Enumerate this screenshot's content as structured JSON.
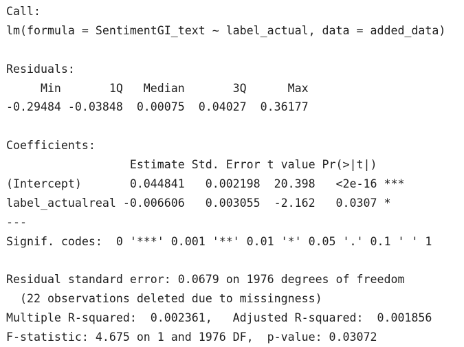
{
  "output": {
    "lines": [
      "Call:",
      "lm(formula = SentimentGI_text ~ label_actual, data = added_data)",
      "",
      "Residuals:",
      "     Min       1Q   Median       3Q      Max ",
      "-0.29484 -0.03848  0.00075  0.04027  0.36177 ",
      "",
      "Coefficients:",
      "                  Estimate Std. Error t value Pr(>|t|)    ",
      "(Intercept)       0.044841   0.002198  20.398   <2e-16 ***",
      "label_actualreal -0.006606   0.003055  -2.162   0.0307 *  ",
      "---",
      "Signif. codes:  0 '***' 0.001 '**' 0.01 '*' 0.05 '.' 0.1 ' ' 1",
      "",
      "Residual standard error: 0.0679 on 1976 degrees of freedom",
      "  (22 observations deleted due to missingness)",
      "Multiple R-squared:  0.002361,\tAdjusted R-squared:  0.001856 ",
      "F-statistic: 4.675 on 1 and 1976 DF,  p-value: 0.03072"
    ]
  }
}
